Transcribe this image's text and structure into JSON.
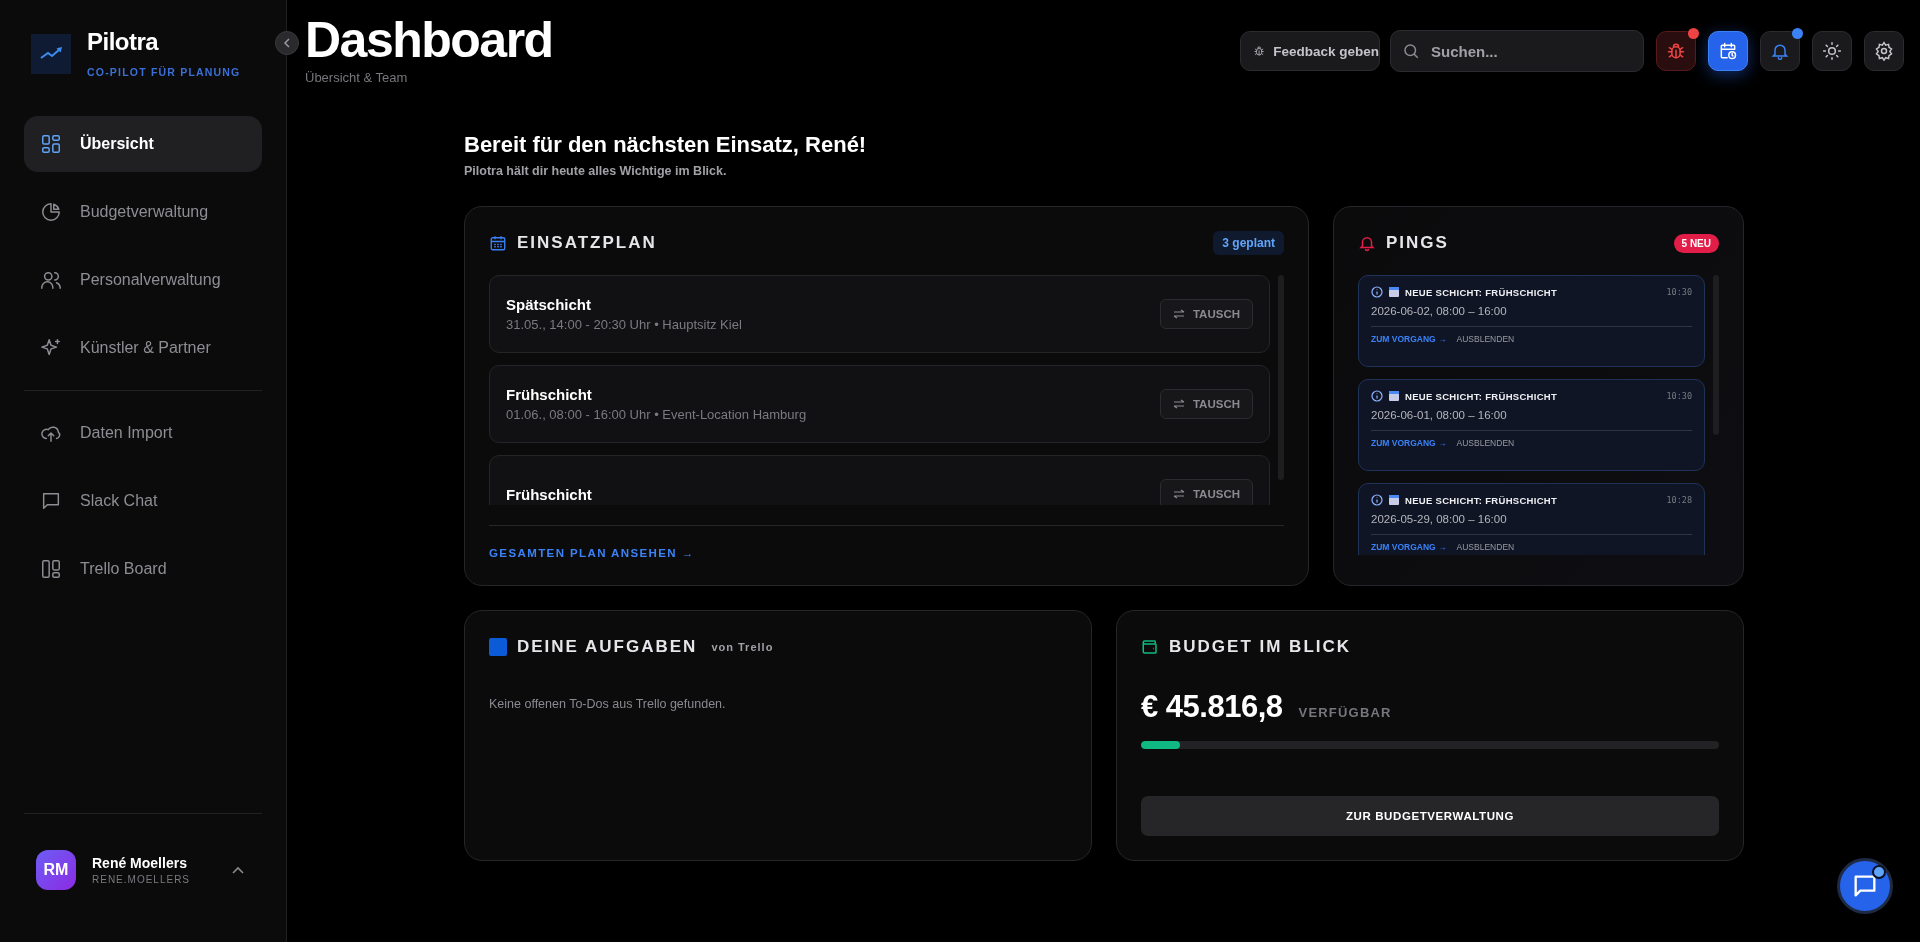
{
  "brand": {
    "name": "Pilotra",
    "tagline": "CO-PILOT FÜR PLANUNG"
  },
  "sidebar": {
    "groups": [
      {
        "items": [
          {
            "label": "Übersicht",
            "selected": true
          },
          {
            "label": "Budgetverwaltung",
            "selected": false
          },
          {
            "label": "Personalverwaltung",
            "selected": false
          },
          {
            "label": "Künstler & Partner",
            "selected": false
          }
        ]
      },
      {
        "items": [
          {
            "label": "Daten Import",
            "selected": false
          },
          {
            "label": "Slack Chat",
            "selected": false
          },
          {
            "label": "Trello Board",
            "selected": false
          }
        ]
      }
    ]
  },
  "user": {
    "initials": "RM",
    "name": "René Moellers",
    "handle": "RENE.MOELLERS"
  },
  "header": {
    "title": "Dashboard",
    "subtitle": "Übersicht & Team"
  },
  "toolbar": {
    "feedback": "Feedback geben",
    "search": {
      "placeholder": "Suchen..."
    },
    "buttons": [
      {
        "selected": false,
        "alert": true,
        "dot": true
      },
      {
        "selected": true,
        "alert": false,
        "dot": false
      },
      {
        "selected": false,
        "alert": false,
        "dot": true
      },
      {
        "selected": false,
        "alert": false,
        "dot": false
      },
      {
        "selected": false,
        "alert": false,
        "dot": false
      }
    ]
  },
  "welcome": {
    "title": "Bereit für den nächsten Einsatz, René!",
    "subtitle": "Pilotra hält dir heute alles Wichtige im Blick."
  },
  "schedule": {
    "title": "EINSATZPLAN",
    "badge": "3 geplant",
    "link": "GESAMTEN PLAN ANSEHEN →",
    "shifts": [
      {
        "name": "Spätschicht",
        "detail": "31.05., 14:00 - 20:30 Uhr • Hauptsitz Kiel",
        "action": "TAUSCH"
      },
      {
        "name": "Frühschicht",
        "detail": "01.06., 08:00 - 16:00 Uhr • Event-Location Hamburg",
        "action": "TAUSCH"
      },
      {
        "name": "Frühschicht",
        "action": "TAUSCH"
      }
    ]
  },
  "pings": {
    "title": "PINGS",
    "badge": "5 NEU",
    "items": [
      {
        "title": "NEUE SCHICHT: FRÜHSCHICHT",
        "time": "10:30",
        "text": "2026-06-02, 08:00 – 16:00",
        "open": "ZUM VORGANG →",
        "hide": "AUSBLENDEN"
      },
      {
        "title": "NEUE SCHICHT: FRÜHSCHICHT",
        "time": "10:30",
        "text": "2026-06-01, 08:00 – 16:00",
        "open": "ZUM VORGANG →",
        "hide": "AUSBLENDEN"
      },
      {
        "title": "NEUE SCHICHT: FRÜHSCHICHT",
        "time": "10:28",
        "text": "2026-05-29, 08:00 – 16:00",
        "open": "ZUM VORGANG →",
        "hide": "AUSBLENDEN"
      }
    ]
  },
  "tasks": {
    "title": "DEINE AUFGABEN",
    "source": "von Trello",
    "empty": "Keine offenen To-Dos aus Trello gefunden."
  },
  "budget": {
    "title": "BUDGET IM BLICK",
    "amount": "€ 45.816,8",
    "label": "VERFÜGBAR",
    "level": 0.067,
    "button": "ZUR BUDGETVERWALTUNG"
  },
  "chat": {
    "dot": true
  }
}
